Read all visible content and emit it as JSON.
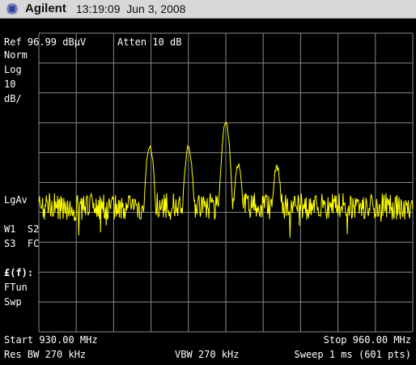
{
  "titlebar": {
    "brand": "Agilent",
    "timestamp": "13:19:09  Jun 3, 2008",
    "logo_icon": "agilent-spark-icon"
  },
  "header": {
    "ref": "Ref 96.99 dBµV",
    "atten": "Atten 10 dB"
  },
  "left_labels": {
    "scale_type": "Norm",
    "scale_mode": "Log",
    "scale_value": "10",
    "scale_unit": "dB/",
    "detector": "LgAv",
    "trace_w1s2": "W1  S2",
    "trace_s3fc": "S3  FC",
    "freq_func": "£(f):",
    "ftun": "FTun",
    "swp": "Swp"
  },
  "footer": {
    "start": "Start 930.00 MHz",
    "stop": "Stop 960.00 MHz",
    "rbw": "Res BW 270 kHz",
    "vbw": "VBW 270 kHz",
    "sweep": "Sweep 1 ms (601 pts)"
  },
  "colors": {
    "background": "#000000",
    "grid": "#8a8a8a",
    "trace": "#ffff00",
    "text": "#ffffff"
  },
  "chart_data": {
    "type": "line",
    "x_range": [
      930,
      960
    ],
    "y_range": [
      -3.01,
      96.99
    ],
    "x_unit": "MHz",
    "y_unit": "dBµV",
    "grid": true,
    "points": 601,
    "noise_floor_db": 39,
    "peaks": [
      {
        "freq": 938.9,
        "level": 59.5
      },
      {
        "freq": 942.0,
        "level": 58.8
      },
      {
        "freq": 945.0,
        "level": 66.8
      },
      {
        "freq": 946.0,
        "level": 52.9
      },
      {
        "freq": 949.1,
        "level": 52.1
      }
    ]
  }
}
